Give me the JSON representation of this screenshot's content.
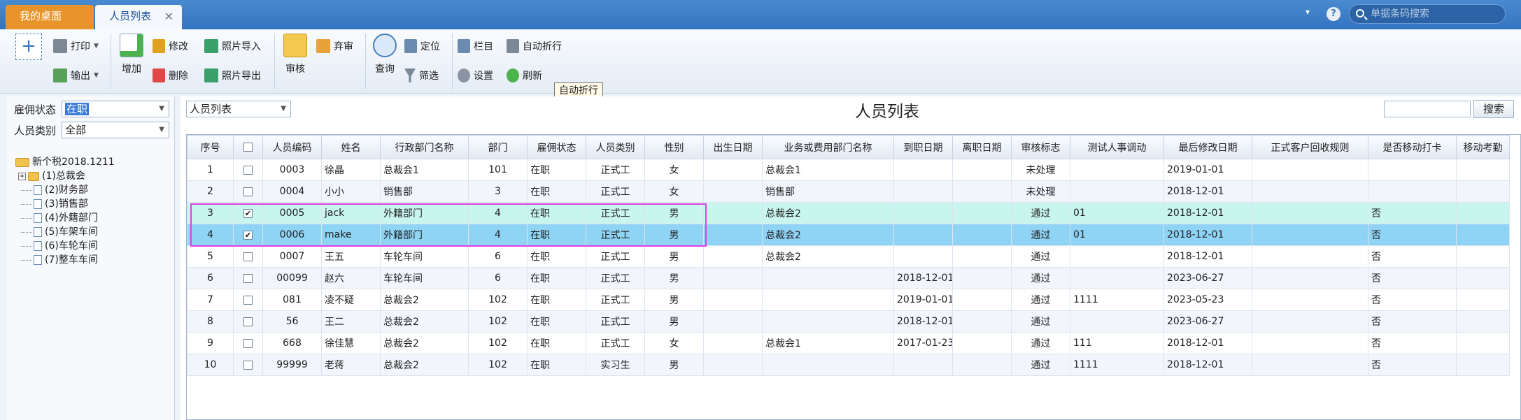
{
  "titlebar": {
    "tabs": [
      {
        "label": "我的桌面"
      },
      {
        "label": "人员列表",
        "close": "✕"
      }
    ],
    "dropdown_glyph": "▾",
    "help_glyph": "?",
    "search_placeholder": "单据条码搜索"
  },
  "toolbar": {
    "new_glyph": "+",
    "print": "打印",
    "export": "输出",
    "add": "增加",
    "edit": "修改",
    "delete": "删除",
    "photo_import": "照片导入",
    "photo_export": "照片导出",
    "review": "审核",
    "discard": "弃审",
    "query": "查询",
    "locate": "定位",
    "filter": "筛选",
    "columns": "栏目",
    "settings": "设置",
    "auto_wrap": "自动折行",
    "refresh": "刷新",
    "tooltip": "自动折行"
  },
  "filters": {
    "employment_label": "雇佣状态",
    "employment_value": "在职",
    "category_label": "人员类别",
    "category_value": "全部"
  },
  "tree": {
    "root": "新个税2018.1211",
    "nodes": [
      {
        "label": "(1)总裁会",
        "expandable": true
      },
      {
        "label": "(2)财务部"
      },
      {
        "label": "(3)销售部"
      },
      {
        "label": "(4)外籍部门"
      },
      {
        "label": "(5)车架车间"
      },
      {
        "label": "(6)车轮车间"
      },
      {
        "label": "(7)整车车间"
      }
    ]
  },
  "main": {
    "view_select": "人员列表",
    "title": "人员列表",
    "search_button": "搜索"
  },
  "grid": {
    "columns": [
      "序号",
      "",
      "人员编码",
      "姓名",
      "行政部门名称",
      "部门",
      "雇佣状态",
      "人员类别",
      "性别",
      "出生日期",
      "业务或费用部门名称",
      "到职日期",
      "离职日期",
      "审核标志",
      "测试人事调动",
      "最后修改日期",
      "正式客户回收规则",
      "是否移动打卡",
      "移动考勤"
    ],
    "rows": [
      {
        "no": "1",
        "checked": false,
        "code": "0003",
        "name": "徐晶",
        "admin_dept": "总裁会1",
        "dept": "101",
        "status": "在职",
        "category": "正式工",
        "gender": "女",
        "birth": "",
        "biz_dept": "总裁会1",
        "join": "",
        "leave": "",
        "audit": "未处理",
        "transfer": "",
        "modified": "2019-01-01",
        "rule": "",
        "mobile_clock": "",
        "mobile_att": ""
      },
      {
        "no": "2",
        "checked": false,
        "code": "0004",
        "name": "小小",
        "admin_dept": "销售部",
        "dept": "3",
        "status": "在职",
        "category": "正式工",
        "gender": "女",
        "birth": "",
        "biz_dept": "销售部",
        "join": "",
        "leave": "",
        "audit": "未处理",
        "transfer": "",
        "modified": "2018-12-01",
        "rule": "",
        "mobile_clock": "",
        "mobile_att": ""
      },
      {
        "no": "3",
        "checked": true,
        "code": "0005",
        "name": "jack",
        "admin_dept": "外籍部门",
        "dept": "4",
        "status": "在职",
        "category": "正式工",
        "gender": "男",
        "birth": "",
        "biz_dept": "总裁会2",
        "join": "",
        "leave": "",
        "audit": "通过",
        "transfer": "01",
        "modified": "2018-12-01",
        "rule": "",
        "mobile_clock": "否",
        "mobile_att": ""
      },
      {
        "no": "4",
        "checked": true,
        "code": "0006",
        "name": "make",
        "admin_dept": "外籍部门",
        "dept": "4",
        "status": "在职",
        "category": "正式工",
        "gender": "男",
        "birth": "",
        "biz_dept": "总裁会2",
        "join": "",
        "leave": "",
        "audit": "通过",
        "transfer": "01",
        "modified": "2018-12-01",
        "rule": "",
        "mobile_clock": "否",
        "mobile_att": ""
      },
      {
        "no": "5",
        "checked": false,
        "code": "0007",
        "name": "王五",
        "admin_dept": "车轮车间",
        "dept": "6",
        "status": "在职",
        "category": "正式工",
        "gender": "男",
        "birth": "",
        "biz_dept": "总裁会2",
        "join": "",
        "leave": "",
        "audit": "通过",
        "transfer": "",
        "modified": "2018-12-01",
        "rule": "",
        "mobile_clock": "否",
        "mobile_att": ""
      },
      {
        "no": "6",
        "checked": false,
        "code": "00099",
        "name": "赵六",
        "admin_dept": "车轮车间",
        "dept": "6",
        "status": "在职",
        "category": "正式工",
        "gender": "男",
        "birth": "",
        "biz_dept": "",
        "join": "2018-12-01",
        "leave": "",
        "audit": "通过",
        "transfer": "",
        "modified": "2023-06-27",
        "rule": "",
        "mobile_clock": "否",
        "mobile_att": ""
      },
      {
        "no": "7",
        "checked": false,
        "code": "081",
        "name": "凌不疑",
        "admin_dept": "总裁会2",
        "dept": "102",
        "status": "在职",
        "category": "正式工",
        "gender": "男",
        "birth": "",
        "biz_dept": "",
        "join": "2019-01-01",
        "leave": "",
        "audit": "通过",
        "transfer": "1111",
        "modified": "2023-05-23",
        "rule": "",
        "mobile_clock": "否",
        "mobile_att": ""
      },
      {
        "no": "8",
        "checked": false,
        "code": "56",
        "name": "王二",
        "admin_dept": "总裁会2",
        "dept": "102",
        "status": "在职",
        "category": "正式工",
        "gender": "男",
        "birth": "",
        "biz_dept": "",
        "join": "2018-12-01",
        "leave": "",
        "audit": "通过",
        "transfer": "",
        "modified": "2023-06-27",
        "rule": "",
        "mobile_clock": "否",
        "mobile_att": ""
      },
      {
        "no": "9",
        "checked": false,
        "code": "668",
        "name": "徐佳慧",
        "admin_dept": "总裁会2",
        "dept": "102",
        "status": "在职",
        "category": "正式工",
        "gender": "女",
        "birth": "",
        "biz_dept": "总裁会1",
        "join": "2017-01-23",
        "leave": "",
        "audit": "通过",
        "transfer": "111",
        "modified": "2018-12-01",
        "rule": "",
        "mobile_clock": "否",
        "mobile_att": ""
      },
      {
        "no": "10",
        "checked": false,
        "code": "99999",
        "name": "老蒋",
        "admin_dept": "总裁会2",
        "dept": "102",
        "status": "在职",
        "category": "实习生",
        "gender": "男",
        "birth": "",
        "biz_dept": "",
        "join": "",
        "leave": "",
        "audit": "通过",
        "transfer": "1111",
        "modified": "2018-12-01",
        "rule": "",
        "mobile_clock": "否",
        "mobile_att": ""
      }
    ]
  },
  "colors": {
    "titlebar": "#3474bf",
    "home_tab": "#e8942a",
    "selected_row_light": "#c8f6ef",
    "selected_row_dark": "#8fd3f5",
    "highlight_box": "#e040e8"
  }
}
